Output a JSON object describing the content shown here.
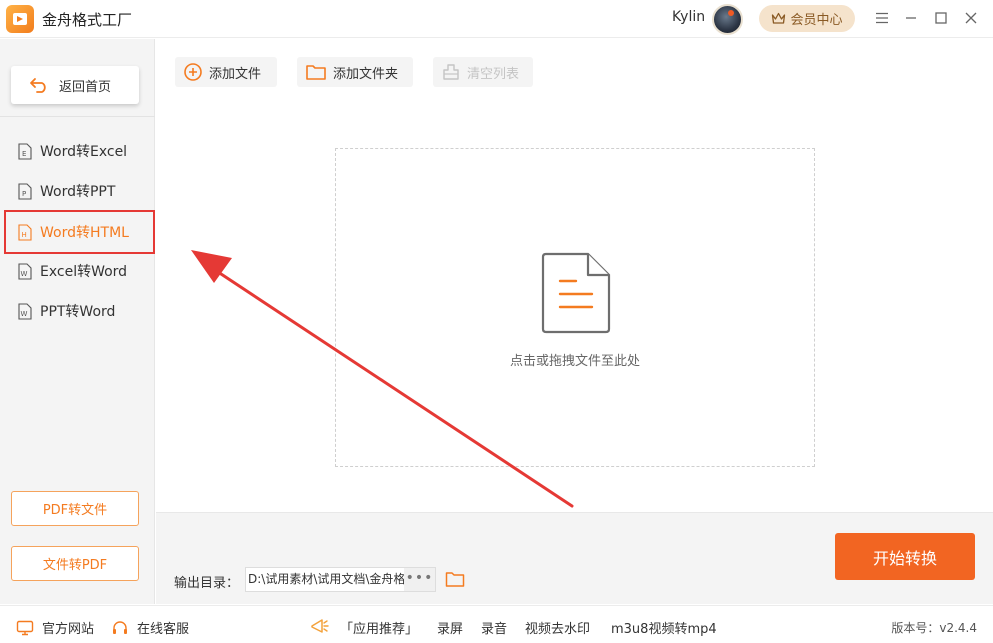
{
  "titlebar": {
    "app_title": "金舟格式工厂",
    "username": "Kylin",
    "vip_label": "会员中心"
  },
  "sidebar": {
    "back_label": "返回首页",
    "items": [
      {
        "label": "Word转Excel",
        "icon_letter": "E"
      },
      {
        "label": "Word转PPT",
        "icon_letter": "P"
      },
      {
        "label": "Word转HTML",
        "icon_letter": "H",
        "active": true
      },
      {
        "label": "Excel转Word",
        "icon_letter": "W"
      },
      {
        "label": "PPT转Word",
        "icon_letter": "W"
      }
    ],
    "pdf_to_file_label": "PDF转文件",
    "file_to_pdf_label": "文件转PDF"
  },
  "toolbar": {
    "add_file_label": "添加文件",
    "add_folder_label": "添加文件夹",
    "clear_list_label": "清空列表"
  },
  "drop_zone": {
    "hint": "点击或拖拽文件至此处"
  },
  "output": {
    "label": "输出目录：",
    "path": "D:\\试用素材\\试用文档\\金舟格",
    "more": "•••"
  },
  "start_label": "开始转换",
  "statusbar": {
    "website": "官方网站",
    "support": "在线客服",
    "recommend": "「应用推荐」",
    "record_screen": "录屏",
    "record_audio": "录音",
    "remove_watermark": "视频去水印",
    "m3u8": "m3u8视频转mp4",
    "version": "版本号：v2.4.4"
  },
  "colors": {
    "accent": "#f26522",
    "annotation": "#e53935"
  }
}
